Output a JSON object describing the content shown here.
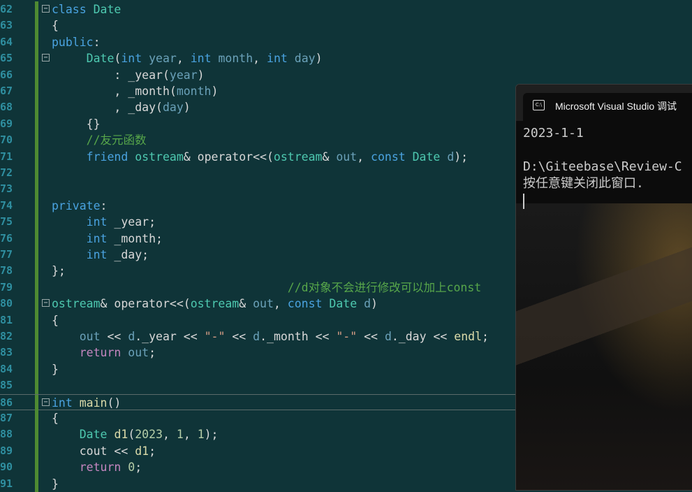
{
  "editor": {
    "lines": [
      {
        "n": "62",
        "tokens": [
          {
            "t": "class",
            "c": "kw"
          },
          {
            "t": " "
          },
          {
            "t": "Date",
            "c": "ty"
          }
        ],
        "fold": true
      },
      {
        "n": "63",
        "tokens": [
          {
            "t": "{"
          }
        ]
      },
      {
        "n": "64",
        "tokens": [
          {
            "t": "public",
            "c": "kw"
          },
          {
            "t": ":"
          }
        ]
      },
      {
        "n": "65",
        "tokens": [
          {
            "t": "     "
          },
          {
            "t": "Date",
            "c": "ty"
          },
          {
            "t": "("
          },
          {
            "t": "int",
            "c": "kw"
          },
          {
            "t": " year",
            "c": "pa"
          },
          {
            "t": ", "
          },
          {
            "t": "int",
            "c": "kw"
          },
          {
            "t": " month",
            "c": "pa"
          },
          {
            "t": ", "
          },
          {
            "t": "int",
            "c": "kw"
          },
          {
            "t": " day",
            "c": "pa"
          },
          {
            "t": ")"
          }
        ],
        "fold": true
      },
      {
        "n": "66",
        "tokens": [
          {
            "t": "         : _year("
          },
          {
            "t": "year",
            "c": "pa"
          },
          {
            "t": ")"
          }
        ]
      },
      {
        "n": "67",
        "tokens": [
          {
            "t": "         , _month("
          },
          {
            "t": "month",
            "c": "pa"
          },
          {
            "t": ")"
          }
        ]
      },
      {
        "n": "68",
        "tokens": [
          {
            "t": "         , _day("
          },
          {
            "t": "day",
            "c": "pa"
          },
          {
            "t": ")"
          }
        ]
      },
      {
        "n": "69",
        "tokens": [
          {
            "t": "     {}"
          }
        ]
      },
      {
        "n": "70",
        "tokens": [
          {
            "t": "     "
          },
          {
            "t": "//友元函数",
            "c": "cm"
          }
        ]
      },
      {
        "n": "71",
        "tokens": [
          {
            "t": "     "
          },
          {
            "t": "friend",
            "c": "kw"
          },
          {
            "t": " "
          },
          {
            "t": "ostream",
            "c": "ty"
          },
          {
            "t": "& operator<<("
          },
          {
            "t": "ostream",
            "c": "ty"
          },
          {
            "t": "& "
          },
          {
            "t": "out",
            "c": "pa"
          },
          {
            "t": ", "
          },
          {
            "t": "const",
            "c": "kw"
          },
          {
            "t": " "
          },
          {
            "t": "Date",
            "c": "ty"
          },
          {
            "t": " "
          },
          {
            "t": "d",
            "c": "pa"
          },
          {
            "t": ");"
          }
        ]
      },
      {
        "n": "72",
        "tokens": []
      },
      {
        "n": "73",
        "tokens": []
      },
      {
        "n": "74",
        "tokens": [
          {
            "t": "private",
            "c": "kw"
          },
          {
            "t": ":"
          }
        ]
      },
      {
        "n": "75",
        "tokens": [
          {
            "t": "     "
          },
          {
            "t": "int",
            "c": "kw"
          },
          {
            "t": " _year;"
          }
        ]
      },
      {
        "n": "76",
        "tokens": [
          {
            "t": "     "
          },
          {
            "t": "int",
            "c": "kw"
          },
          {
            "t": " _month;"
          }
        ]
      },
      {
        "n": "77",
        "tokens": [
          {
            "t": "     "
          },
          {
            "t": "int",
            "c": "kw"
          },
          {
            "t": " _day;"
          }
        ]
      },
      {
        "n": "78",
        "tokens": [
          {
            "t": "};"
          }
        ]
      },
      {
        "n": "79",
        "tokens": [
          {
            "t": "                                  "
          },
          {
            "t": "//d对象不会进行修改可以加上const",
            "c": "cm"
          }
        ]
      },
      {
        "n": "80",
        "tokens": [
          {
            "t": "ostream",
            "c": "ty"
          },
          {
            "t": "& operator<<("
          },
          {
            "t": "ostream",
            "c": "ty"
          },
          {
            "t": "& "
          },
          {
            "t": "out",
            "c": "pa"
          },
          {
            "t": ", "
          },
          {
            "t": "const",
            "c": "kw"
          },
          {
            "t": " "
          },
          {
            "t": "Date",
            "c": "ty"
          },
          {
            "t": " "
          },
          {
            "t": "d",
            "c": "pa"
          },
          {
            "t": ")"
          }
        ],
        "fold": true
      },
      {
        "n": "81",
        "tokens": [
          {
            "t": "{"
          }
        ]
      },
      {
        "n": "82",
        "tokens": [
          {
            "t": "    "
          },
          {
            "t": "out",
            "c": "pa"
          },
          {
            "t": " << "
          },
          {
            "t": "d",
            "c": "pa"
          },
          {
            "t": "._year << "
          },
          {
            "t": "\"-\"",
            "c": "str"
          },
          {
            "t": " << "
          },
          {
            "t": "d",
            "c": "pa"
          },
          {
            "t": "._month << "
          },
          {
            "t": "\"-\"",
            "c": "str"
          },
          {
            "t": " << "
          },
          {
            "t": "d",
            "c": "pa"
          },
          {
            "t": "._day << "
          },
          {
            "t": "endl",
            "c": "fn"
          },
          {
            "t": ";"
          }
        ]
      },
      {
        "n": "83",
        "tokens": [
          {
            "t": "    "
          },
          {
            "t": "return",
            "c": "kw2"
          },
          {
            "t": " "
          },
          {
            "t": "out",
            "c": "pa"
          },
          {
            "t": ";"
          }
        ]
      },
      {
        "n": "84",
        "tokens": [
          {
            "t": "}"
          }
        ]
      },
      {
        "n": "85",
        "tokens": []
      },
      {
        "n": "86",
        "tokens": [
          {
            "t": "int",
            "c": "kw"
          },
          {
            "t": " "
          },
          {
            "t": "main",
            "c": "fn"
          },
          {
            "t": "()"
          }
        ],
        "fold": true,
        "current": true
      },
      {
        "n": "87",
        "tokens": [
          {
            "t": "{"
          }
        ]
      },
      {
        "n": "88",
        "tokens": [
          {
            "t": "    "
          },
          {
            "t": "Date",
            "c": "ty"
          },
          {
            "t": " "
          },
          {
            "t": "d1",
            "c": "fn"
          },
          {
            "t": "("
          },
          {
            "t": "2023",
            "c": "num"
          },
          {
            "t": ", "
          },
          {
            "t": "1",
            "c": "num"
          },
          {
            "t": ", "
          },
          {
            "t": "1",
            "c": "num"
          },
          {
            "t": ");"
          }
        ]
      },
      {
        "n": "89",
        "tokens": [
          {
            "t": "    cout << "
          },
          {
            "t": "d1",
            "c": "fn"
          },
          {
            "t": ";"
          }
        ]
      },
      {
        "n": "90",
        "tokens": [
          {
            "t": "    "
          },
          {
            "t": "return",
            "c": "kw2"
          },
          {
            "t": " "
          },
          {
            "t": "0",
            "c": "num"
          },
          {
            "t": ";"
          }
        ]
      },
      {
        "n": "91",
        "tokens": [
          {
            "t": "}"
          }
        ]
      }
    ]
  },
  "console": {
    "title": "Microsoft Visual Studio 调试",
    "icon": "console-icon",
    "lines": [
      "2023-1-1",
      "",
      "D:\\Giteebase\\Review-C",
      "按任意键关闭此窗口."
    ]
  }
}
